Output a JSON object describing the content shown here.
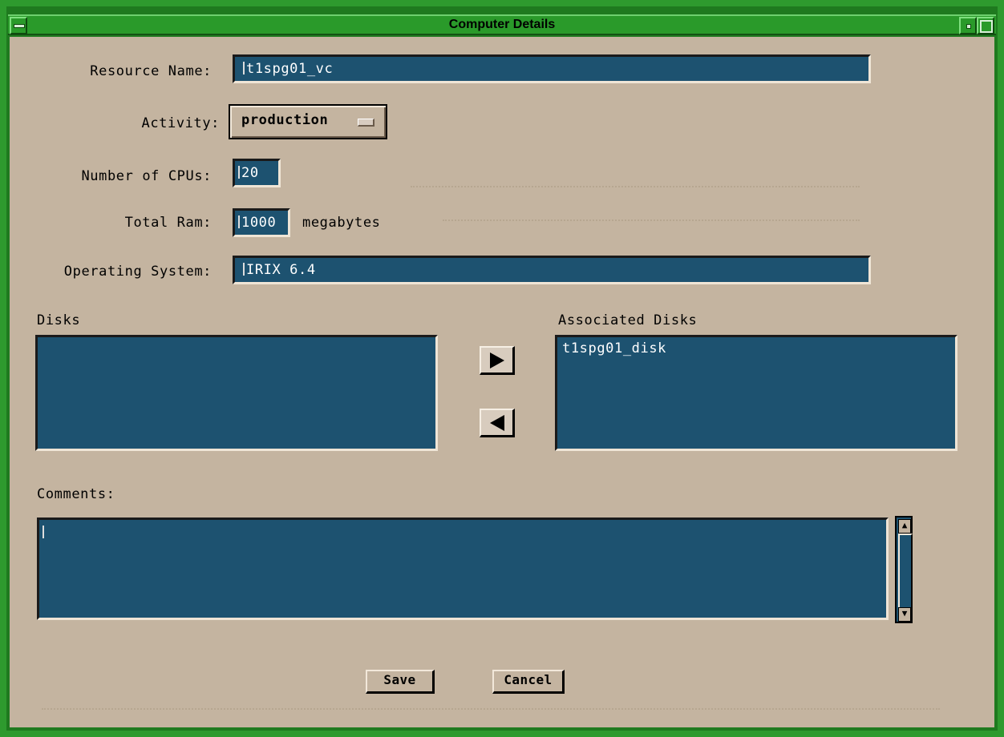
{
  "window": {
    "title": "Computer Details"
  },
  "form": {
    "resource_name": {
      "label": "Resource Name:",
      "value": "t1spg01_vc"
    },
    "activity": {
      "label": "Activity:",
      "value": "production"
    },
    "cpus": {
      "label": "Number of CPUs:",
      "value": "20"
    },
    "ram": {
      "label": "Total Ram:",
      "value": "1000",
      "unit": "megabytes"
    },
    "os": {
      "label": "Operating System:",
      "value": "IRIX 6.4"
    }
  },
  "disks": {
    "available_label": "Disks",
    "available_items": [],
    "associated_label": "Associated Disks",
    "associated_items": [
      "t1spg01_disk"
    ]
  },
  "comments": {
    "label": "Comments:",
    "value": ""
  },
  "actions": {
    "save_label": "Save",
    "cancel_label": "Cancel"
  },
  "colors": {
    "field_bg": "#1d5270",
    "window_bg": "#c4b4a0",
    "frame": "#2e9a2e"
  }
}
